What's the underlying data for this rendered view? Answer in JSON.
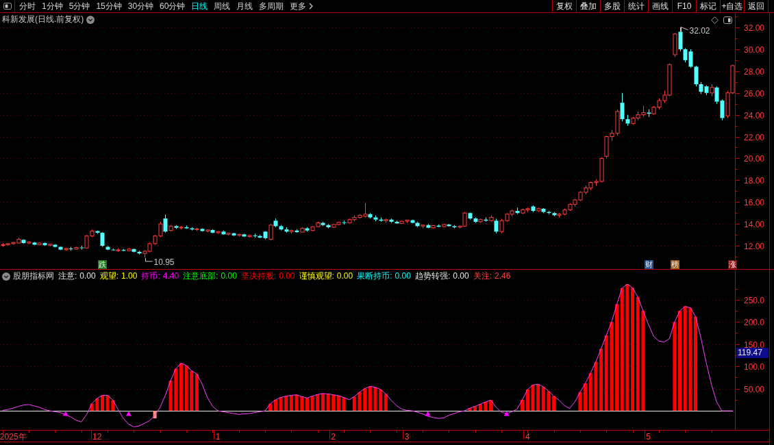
{
  "toolbar": {
    "tabs": [
      {
        "label": "分时",
        "selected": false
      },
      {
        "label": "1分钟",
        "selected": false
      },
      {
        "label": "5分钟",
        "selected": false
      },
      {
        "label": "15分钟",
        "selected": false
      },
      {
        "label": "30分钟",
        "selected": false
      },
      {
        "label": "60分钟",
        "selected": false
      },
      {
        "label": "日线",
        "selected": true
      },
      {
        "label": "周线",
        "selected": false
      },
      {
        "label": "月线",
        "selected": false
      },
      {
        "label": "多周期",
        "selected": false
      }
    ],
    "more_menu": "更多",
    "buttons": [
      "复权",
      "叠加",
      "多股",
      "统计",
      "画线",
      "F10",
      "标记",
      "+自选",
      "返回"
    ]
  },
  "main_chart": {
    "title": "科新发展(日线.前复权)",
    "signal_marks": [
      {
        "text": "跌",
        "color": "#1e7a1e"
      },
      {
        "text": "财",
        "color": "#23508e"
      },
      {
        "text": "榜",
        "color": "#a0581c"
      },
      {
        "text": "涨",
        "color": "#8c1212"
      }
    ],
    "chart_data": [
      {
        "type": "candlestick",
        "ylim": [
          9.87,
          33.32
        ],
        "yticks": [
          {
            "value": 12,
            "label": "12.00"
          },
          {
            "value": 14,
            "label": "14.00"
          },
          {
            "value": 16,
            "label": "16.00"
          },
          {
            "value": 18,
            "label": "18.00"
          },
          {
            "value": 20,
            "label": "20.00"
          },
          {
            "value": 22,
            "label": "22.00"
          },
          {
            "value": 24,
            "label": "24.00"
          },
          {
            "value": 26,
            "label": "26.00"
          },
          {
            "value": 28,
            "label": "28.00"
          },
          {
            "value": 30,
            "label": "30.00"
          },
          {
            "value": 32,
            "label": "32.00"
          }
        ],
        "grid": true,
        "annotations": [
          "32.02",
          "10.95"
        ],
        "ohlc": [
          [
            12.05,
            12.25,
            11.9,
            12.1
          ],
          [
            12.1,
            12.25,
            12.0,
            12.2
          ],
          [
            12.2,
            12.35,
            12.1,
            12.3
          ],
          [
            12.25,
            12.75,
            12.2,
            12.6
          ],
          [
            12.55,
            12.6,
            12.2,
            12.25
          ],
          [
            12.25,
            12.4,
            12.15,
            12.35
          ],
          [
            12.3,
            12.35,
            12.05,
            12.1
          ],
          [
            12.1,
            12.3,
            12.05,
            12.25
          ],
          [
            12.25,
            12.3,
            12.0,
            12.05
          ],
          [
            12.05,
            12.2,
            11.95,
            12.15
          ],
          [
            12.1,
            12.15,
            11.85,
            11.9
          ],
          [
            11.9,
            11.95,
            11.6,
            11.65
          ],
          [
            11.65,
            11.8,
            11.55,
            11.75
          ],
          [
            11.75,
            11.9,
            11.55,
            11.7
          ],
          [
            11.7,
            11.9,
            11.65,
            11.85
          ],
          [
            11.85,
            12.0,
            11.65,
            11.8
          ],
          [
            11.8,
            13.0,
            11.75,
            12.9
          ],
          [
            12.9,
            13.5,
            12.8,
            13.35
          ],
          [
            13.35,
            13.4,
            13.1,
            13.2
          ],
          [
            13.2,
            13.25,
            11.9,
            12.0
          ],
          [
            11.9,
            12.0,
            11.6,
            11.65
          ],
          [
            11.65,
            11.75,
            11.55,
            11.6
          ],
          [
            11.6,
            11.78,
            11.45,
            11.62
          ],
          [
            11.62,
            11.7,
            11.5,
            11.55
          ],
          [
            11.55,
            11.8,
            11.5,
            11.7
          ],
          [
            11.7,
            11.75,
            11.4,
            11.45
          ],
          [
            11.45,
            11.55,
            11.2,
            11.3
          ],
          [
            11.3,
            11.6,
            10.95,
            11.5
          ],
          [
            11.5,
            12.3,
            11.4,
            12.2
          ],
          [
            12.2,
            13.0,
            12.1,
            12.9
          ],
          [
            12.9,
            14.2,
            12.8,
            14.0
          ],
          [
            14.5,
            14.85,
            13.2,
            13.3
          ],
          [
            13.4,
            13.9,
            13.3,
            13.8
          ],
          [
            13.8,
            13.9,
            13.55,
            13.65
          ],
          [
            13.65,
            13.8,
            13.5,
            13.7
          ],
          [
            13.7,
            13.85,
            13.55,
            13.6
          ],
          [
            13.6,
            13.7,
            13.4,
            13.5
          ],
          [
            13.5,
            13.65,
            13.35,
            13.55
          ],
          [
            13.55,
            13.6,
            13.3,
            13.35
          ],
          [
            13.35,
            13.5,
            13.25,
            13.45
          ],
          [
            13.45,
            13.5,
            13.15,
            13.2
          ],
          [
            13.2,
            13.35,
            13.1,
            13.3
          ],
          [
            13.3,
            13.4,
            13.0,
            13.05
          ],
          [
            13.05,
            13.2,
            12.95,
            13.15
          ],
          [
            13.15,
            13.2,
            12.9,
            12.95
          ],
          [
            12.95,
            13.1,
            12.85,
            13.05
          ],
          [
            13.05,
            13.1,
            12.8,
            12.85
          ],
          [
            12.85,
            13.0,
            12.75,
            12.95
          ],
          [
            12.95,
            13.12,
            12.75,
            12.9
          ],
          [
            12.9,
            13.0,
            12.7,
            12.75
          ],
          [
            13.3,
            13.35,
            12.6,
            12.7
          ],
          [
            12.6,
            14.0,
            12.5,
            13.9
          ],
          [
            14.3,
            14.5,
            13.7,
            13.8
          ],
          [
            13.8,
            13.9,
            13.4,
            13.5
          ],
          [
            13.5,
            13.7,
            13.2,
            13.3
          ],
          [
            13.3,
            13.5,
            13.1,
            13.4
          ],
          [
            13.4,
            13.5,
            13.2,
            13.25
          ],
          [
            13.25,
            13.7,
            13.2,
            13.6
          ],
          [
            13.6,
            13.7,
            13.3,
            13.4
          ],
          [
            13.4,
            13.8,
            13.35,
            13.75
          ],
          [
            13.75,
            14.2,
            13.7,
            14.1
          ],
          [
            14.1,
            14.2,
            13.8,
            13.9
          ],
          [
            13.9,
            14.0,
            13.6,
            13.7
          ],
          [
            13.7,
            14.0,
            13.65,
            13.95
          ],
          [
            13.95,
            14.2,
            13.9,
            14.15
          ],
          [
            14.15,
            14.3,
            13.95,
            14.1
          ],
          [
            14.1,
            14.5,
            14.05,
            14.4
          ],
          [
            14.4,
            14.78,
            14.25,
            14.6
          ],
          [
            14.6,
            14.9,
            14.5,
            14.8
          ],
          [
            14.7,
            15.9,
            14.6,
            14.9
          ],
          [
            14.9,
            15.0,
            14.5,
            14.6
          ],
          [
            14.6,
            14.78,
            14.25,
            14.4
          ],
          [
            14.4,
            14.6,
            14.2,
            14.3
          ],
          [
            14.3,
            14.5,
            14.1,
            14.4
          ],
          [
            14.4,
            14.5,
            14.1,
            14.2
          ],
          [
            14.2,
            14.3,
            14.0,
            14.05
          ],
          [
            14.05,
            14.3,
            14.0,
            14.25
          ],
          [
            14.25,
            14.4,
            14.1,
            14.35
          ],
          [
            14.35,
            14.4,
            14.05,
            14.1
          ],
          [
            14.1,
            14.2,
            13.7,
            13.8
          ],
          [
            13.8,
            13.95,
            13.6,
            13.9
          ],
          [
            13.9,
            14.0,
            13.6,
            13.65
          ],
          [
            13.65,
            13.9,
            13.6,
            13.85
          ],
          [
            13.85,
            13.95,
            13.7,
            13.75
          ],
          [
            13.75,
            14.0,
            13.7,
            13.95
          ],
          [
            13.95,
            14.0,
            13.75,
            13.8
          ],
          [
            13.8,
            13.9,
            13.6,
            13.7
          ],
          [
            13.7,
            13.85,
            13.6,
            13.8
          ],
          [
            13.8,
            15.1,
            13.75,
            15.0
          ],
          [
            15.0,
            15.05,
            14.4,
            14.5
          ],
          [
            14.5,
            14.6,
            14.1,
            14.2
          ],
          [
            14.2,
            14.5,
            14.1,
            14.4
          ],
          [
            14.4,
            14.6,
            14.2,
            14.3
          ],
          [
            14.3,
            14.8,
            14.2,
            14.6
          ],
          [
            14.3,
            14.48,
            13.15,
            13.3
          ],
          [
            13.3,
            14.48,
            13.15,
            14.3
          ],
          [
            14.3,
            15.0,
            14.2,
            14.9
          ],
          [
            14.9,
            15.3,
            14.7,
            15.2
          ],
          [
            15.2,
            15.5,
            14.9,
            15.0
          ],
          [
            15.0,
            15.4,
            14.9,
            15.3
          ],
          [
            15.3,
            15.5,
            15.1,
            15.4
          ],
          [
            15.6,
            15.7,
            15.1,
            15.2
          ],
          [
            15.2,
            15.5,
            15.1,
            15.4
          ],
          [
            15.4,
            15.45,
            15.0,
            15.1
          ],
          [
            15.1,
            15.2,
            14.9,
            15.0
          ],
          [
            15.0,
            15.1,
            14.7,
            14.8
          ],
          [
            14.8,
            15.0,
            14.6,
            14.9
          ],
          [
            14.9,
            15.4,
            14.8,
            15.3
          ],
          [
            15.3,
            15.9,
            15.2,
            15.8
          ],
          [
            15.8,
            16.3,
            15.6,
            16.2
          ],
          [
            16.2,
            17.0,
            16.1,
            16.9
          ],
          [
            16.9,
            17.5,
            16.7,
            17.3
          ],
          [
            17.3,
            17.9,
            17.1,
            17.8
          ],
          [
            17.8,
            18.1,
            17.5,
            17.9
          ],
          [
            17.9,
            20.1,
            17.8,
            20.0
          ],
          [
            20.2,
            22.1,
            20.0,
            22.0
          ],
          [
            22.0,
            22.6,
            21.6,
            22.3
          ],
          [
            22.3,
            24.5,
            22.1,
            24.3
          ],
          [
            25.1,
            26.0,
            23.4,
            23.6
          ],
          [
            23.6,
            24.0,
            23.0,
            23.2
          ],
          [
            23.2,
            23.8,
            23.1,
            23.7
          ],
          [
            23.7,
            24.3,
            23.5,
            24.0
          ],
          [
            24.0,
            24.8,
            23.8,
            24.2
          ],
          [
            24.2,
            24.5,
            23.8,
            24.1
          ],
          [
            24.1,
            24.8,
            24.0,
            24.7
          ],
          [
            24.7,
            25.5,
            24.5,
            25.3
          ],
          [
            25.3,
            26.2,
            25.1,
            25.8
          ],
          [
            25.8,
            28.7,
            25.7,
            28.6
          ],
          [
            29.5,
            31.5,
            29.3,
            31.4
          ],
          [
            31.6,
            32.02,
            29.8,
            30.0
          ],
          [
            30.0,
            30.1,
            28.8,
            29.0
          ],
          [
            29.8,
            30.0,
            28.3,
            28.4
          ],
          [
            28.4,
            28.5,
            26.6,
            26.8
          ],
          [
            26.8,
            27.0,
            25.9,
            26.1
          ],
          [
            26.6,
            26.7,
            25.8,
            26.0
          ],
          [
            26.0,
            26.8,
            25.7,
            26.5
          ],
          [
            26.5,
            26.6,
            25.0,
            25.2
          ],
          [
            25.3,
            25.4,
            23.5,
            23.7
          ],
          [
            23.9,
            26.2,
            23.7,
            26.0
          ],
          [
            26.0,
            28.6,
            25.9,
            28.5
          ]
        ]
      }
    ]
  },
  "indicator_panel": {
    "name": "股朋指标网",
    "legend": [
      {
        "label": "注意:",
        "value": "0.00",
        "color": "#e8e8e8"
      },
      {
        "label": "观望:",
        "value": "1.00",
        "color": "#ffff00"
      },
      {
        "label": "持币:",
        "value": "4.40",
        "color": "#ff00ff"
      },
      {
        "label": "注意底部:",
        "value": "0.00",
        "color": "#00ff00"
      },
      {
        "label": "坚决持股:",
        "value": "0.00",
        "color": "#ff0000"
      },
      {
        "label": "谨慎观望:",
        "value": "0.00",
        "color": "#ffff00"
      },
      {
        "label": "果断持币:",
        "value": "0.00",
        "color": "#00ffff"
      },
      {
        "label": "趋势转强:",
        "value": "0.00",
        "color": "#e8e8e8"
      },
      {
        "label": "关注:",
        "value": "2.46",
        "color": "#ff4040"
      }
    ],
    "value_tag": "119.47",
    "chart_data": [
      {
        "type": "bar",
        "ylim": [
          -43,
          319
        ],
        "yticks": [
          {
            "value": 50,
            "label": "50.00"
          },
          {
            "value": 100,
            "label": "100.0"
          },
          {
            "value": 150,
            "label": "150.0"
          },
          {
            "value": 200,
            "label": "200.0"
          },
          {
            "value": 250,
            "label": "250.0"
          }
        ],
        "grid": true,
        "categories": [
          null,
          null,
          "2025年",
          null,
          null,
          null,
          null,
          null,
          null,
          null,
          null,
          null,
          null,
          null,
          null,
          null,
          null,
          null,
          "12",
          null,
          null,
          null,
          null,
          null,
          null,
          null,
          null,
          null,
          null,
          null,
          null,
          null,
          null,
          null,
          null,
          null,
          null,
          null,
          null,
          null,
          null,
          "1",
          null,
          null,
          null,
          null,
          null,
          null,
          null,
          null,
          null,
          null,
          null,
          null,
          null,
          null,
          null,
          null,
          null,
          null,
          null,
          null,
          null,
          "2",
          null,
          null,
          null,
          null,
          null,
          null,
          null,
          null,
          null,
          null,
          null,
          null,
          null,
          "3",
          null,
          null,
          null,
          null,
          null,
          null,
          null,
          null,
          null,
          null,
          null,
          null,
          null,
          null,
          null,
          null,
          null,
          null,
          null,
          null,
          null,
          null,
          "4",
          null,
          null,
          null,
          null,
          null,
          null,
          null,
          null,
          null,
          null,
          null,
          null,
          null,
          null,
          null,
          null,
          null,
          null,
          null,
          null,
          null,
          null,
          "5",
          null,
          null,
          null,
          null,
          null,
          null,
          null,
          null,
          null,
          null,
          null,
          null,
          null,
          null,
          null,
          null
        ],
        "series": [
          {
            "type": "bar",
            "color": "#ff0000",
            "values": [
              null,
              null,
              null,
              null,
              null,
              null,
              null,
              null,
              null,
              null,
              null,
              null,
              null,
              null,
              null,
              null,
              null,
              16,
              28,
              35,
              35,
              24,
              null,
              null,
              null,
              null,
              null,
              null,
              null,
              null,
              null,
              null,
              68,
              95,
              107,
              102,
              90,
              83,
              null,
              null,
              null,
              null,
              null,
              null,
              null,
              null,
              null,
              null,
              null,
              null,
              null,
              16,
              25,
              30,
              33,
              35,
              36,
              32,
              29,
              33,
              37,
              39,
              38,
              36,
              34,
              30,
              null,
              32,
              42,
              50,
              55,
              53,
              48,
              38,
              null,
              null,
              null,
              null,
              null,
              null,
              null,
              null,
              null,
              null,
              null,
              null,
              null,
              null,
              null,
              6,
              10,
              15,
              20,
              24,
              null,
              null,
              null,
              null,
              null,
              25,
              48,
              58,
              60,
              54,
              44,
              33,
              null,
              null,
              null,
              null,
              42,
              62,
              85,
              110,
              140,
              170,
              200,
              240,
              276,
              285,
              277,
              256,
              225,
              null,
              null,
              null,
              null,
              null,
              200,
              225,
              235,
              232,
              212,
              null,
              null,
              null,
              null,
              null,
              null,
              null
            ]
          },
          {
            "type": "bar",
            "color": "#ff9080",
            "values": [
              null,
              null,
              null,
              null,
              null,
              null,
              null,
              null,
              null,
              null,
              null,
              null,
              null,
              null,
              null,
              null,
              null,
              null,
              null,
              null,
              null,
              null,
              null,
              null,
              null,
              null,
              null,
              null,
              null,
              -17,
              null,
              null,
              null,
              null,
              null,
              null,
              null,
              null,
              null,
              null,
              null,
              null,
              null,
              null,
              null,
              null,
              null,
              null,
              null,
              null,
              null,
              null,
              null,
              null,
              null,
              null,
              null,
              null,
              null,
              null,
              null,
              null,
              null,
              null,
              null,
              null,
              null,
              null,
              null,
              null,
              null,
              null,
              null,
              null,
              null,
              null,
              null,
              null,
              null,
              null,
              null,
              null,
              null,
              null,
              null,
              null,
              null,
              null,
              null,
              null,
              null,
              null,
              null,
              null,
              null,
              null,
              null,
              null,
              null,
              null,
              null,
              null,
              null,
              null,
              null,
              null,
              null,
              null,
              null,
              null,
              null,
              null,
              null,
              null,
              null,
              null,
              null,
              null,
              null,
              null,
              null,
              null,
              null,
              null,
              null,
              null,
              null,
              null,
              null,
              null,
              null,
              null,
              null,
              null,
              null,
              null,
              null,
              null,
              null,
              null
            ]
          },
          {
            "type": "line",
            "color": "#ff40ff",
            "values": [
              1,
              3,
              6,
              10,
              13,
              14,
              11,
              8,
              3,
              0,
              -2,
              -4,
              -9,
              -14,
              -21,
              -25,
              -8,
              16,
              28,
              35,
              35,
              24,
              3,
              -17,
              -30,
              -36,
              -34,
              -28,
              -22,
              -10,
              8,
              35,
              68,
              95,
              107,
              102,
              90,
              83,
              60,
              30,
              10,
              0,
              -2,
              -4,
              -6,
              -8,
              -7,
              -6,
              -4,
              -2,
              0,
              16,
              25,
              30,
              33,
              35,
              36,
              32,
              29,
              33,
              37,
              39,
              38,
              36,
              34,
              30,
              25,
              32,
              42,
              50,
              55,
              53,
              48,
              38,
              24,
              12,
              4,
              1,
              0,
              -3,
              -7,
              -12,
              -15,
              -17,
              -16,
              -10,
              -6,
              -2,
              0,
              6,
              10,
              15,
              20,
              24,
              8,
              -3,
              -6,
              -2,
              4,
              25,
              48,
              58,
              60,
              54,
              44,
              33,
              24,
              12,
              5,
              20,
              42,
              62,
              85,
              110,
              140,
              170,
              200,
              240,
              276,
              285,
              277,
              256,
              225,
              195,
              168,
              157,
              155,
              162,
              200,
              225,
              235,
              232,
              212,
              165,
              110,
              60,
              20,
              0,
              0,
              0
            ]
          },
          {
            "type": "scatter",
            "marker": "triangle",
            "color": "#ff00ff",
            "values": [
              null,
              null,
              null,
              null,
              null,
              null,
              null,
              null,
              null,
              null,
              null,
              null,
              -6,
              null,
              null,
              null,
              null,
              null,
              null,
              null,
              null,
              null,
              null,
              null,
              -6,
              null,
              null,
              null,
              null,
              null,
              null,
              null,
              null,
              null,
              null,
              null,
              null,
              null,
              null,
              null,
              null,
              null,
              null,
              null,
              null,
              null,
              null,
              null,
              null,
              null,
              null,
              null,
              null,
              null,
              null,
              null,
              null,
              null,
              null,
              null,
              null,
              null,
              null,
              null,
              null,
              null,
              null,
              null,
              null,
              null,
              null,
              null,
              null,
              null,
              null,
              null,
              null,
              null,
              null,
              null,
              null,
              -6,
              null,
              null,
              null,
              null,
              null,
              null,
              null,
              null,
              null,
              null,
              null,
              null,
              null,
              null,
              -6,
              null,
              null,
              null,
              null,
              null,
              null,
              null,
              null,
              null,
              null,
              null,
              null,
              null,
              null,
              null,
              null,
              null,
              null,
              null,
              null,
              null,
              null,
              null,
              null,
              null,
              null,
              null,
              null,
              null,
              null,
              null,
              null,
              null,
              null,
              null,
              null,
              null,
              null,
              null,
              null,
              null,
              null,
              null
            ]
          }
        ]
      }
    ]
  }
}
